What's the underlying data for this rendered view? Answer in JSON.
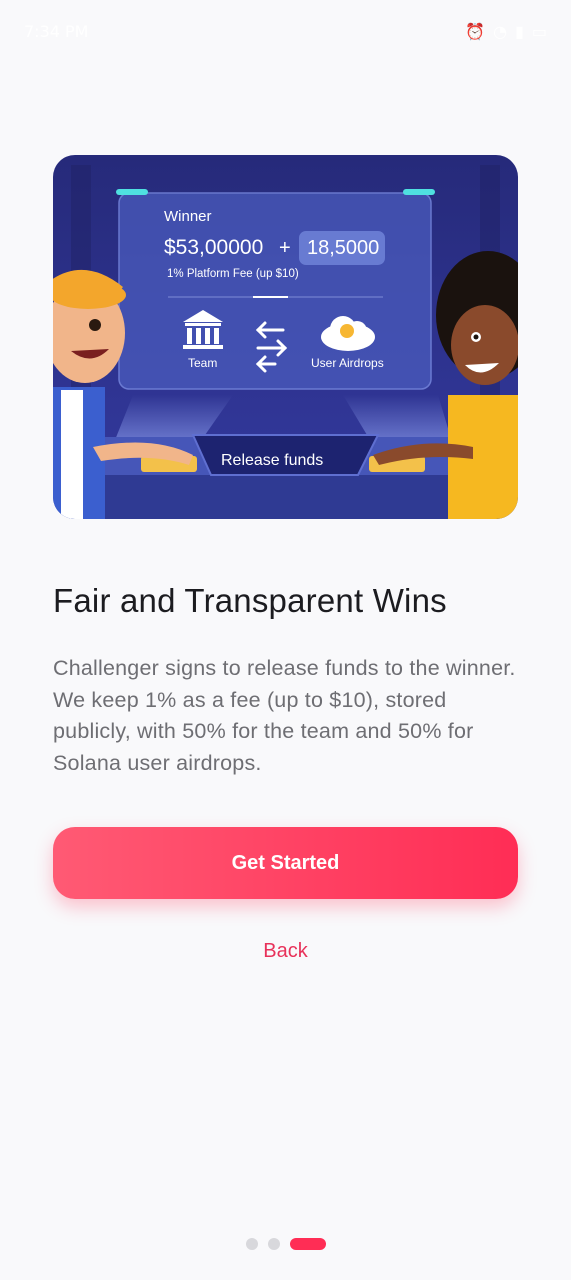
{
  "status_bar": {
    "time": "7:34 PM",
    "icons": [
      "alarm-icon",
      "data-icon",
      "wifi-icon",
      "signal-icon",
      "signal-icon",
      "battery-icon"
    ]
  },
  "illustration": {
    "winner_label": "Winner",
    "winner_amount": "$53,00000",
    "plus": "+",
    "bonus_amount": "18,5000",
    "fee_note": "1% Platform Fee (up $10)",
    "team_label": "Team",
    "airdrops_label": "User Airdrops",
    "release_label": "Release funds",
    "colors": {
      "background": "#2c2f86",
      "panel": "#3c4aa6",
      "skin": "#8a4a2c"
    }
  },
  "content": {
    "title": "Fair and Transparent Wins",
    "description": "Challenger signs to release funds to the winner. We keep 1% as a fee (up to $10), stored publicly, with 50% for the team and 50% for Solana user airdrops."
  },
  "actions": {
    "primary_label": "Get Started",
    "secondary_label": "Back",
    "accent": "#ff2d55"
  },
  "pager": {
    "total": 3,
    "active": 3
  }
}
